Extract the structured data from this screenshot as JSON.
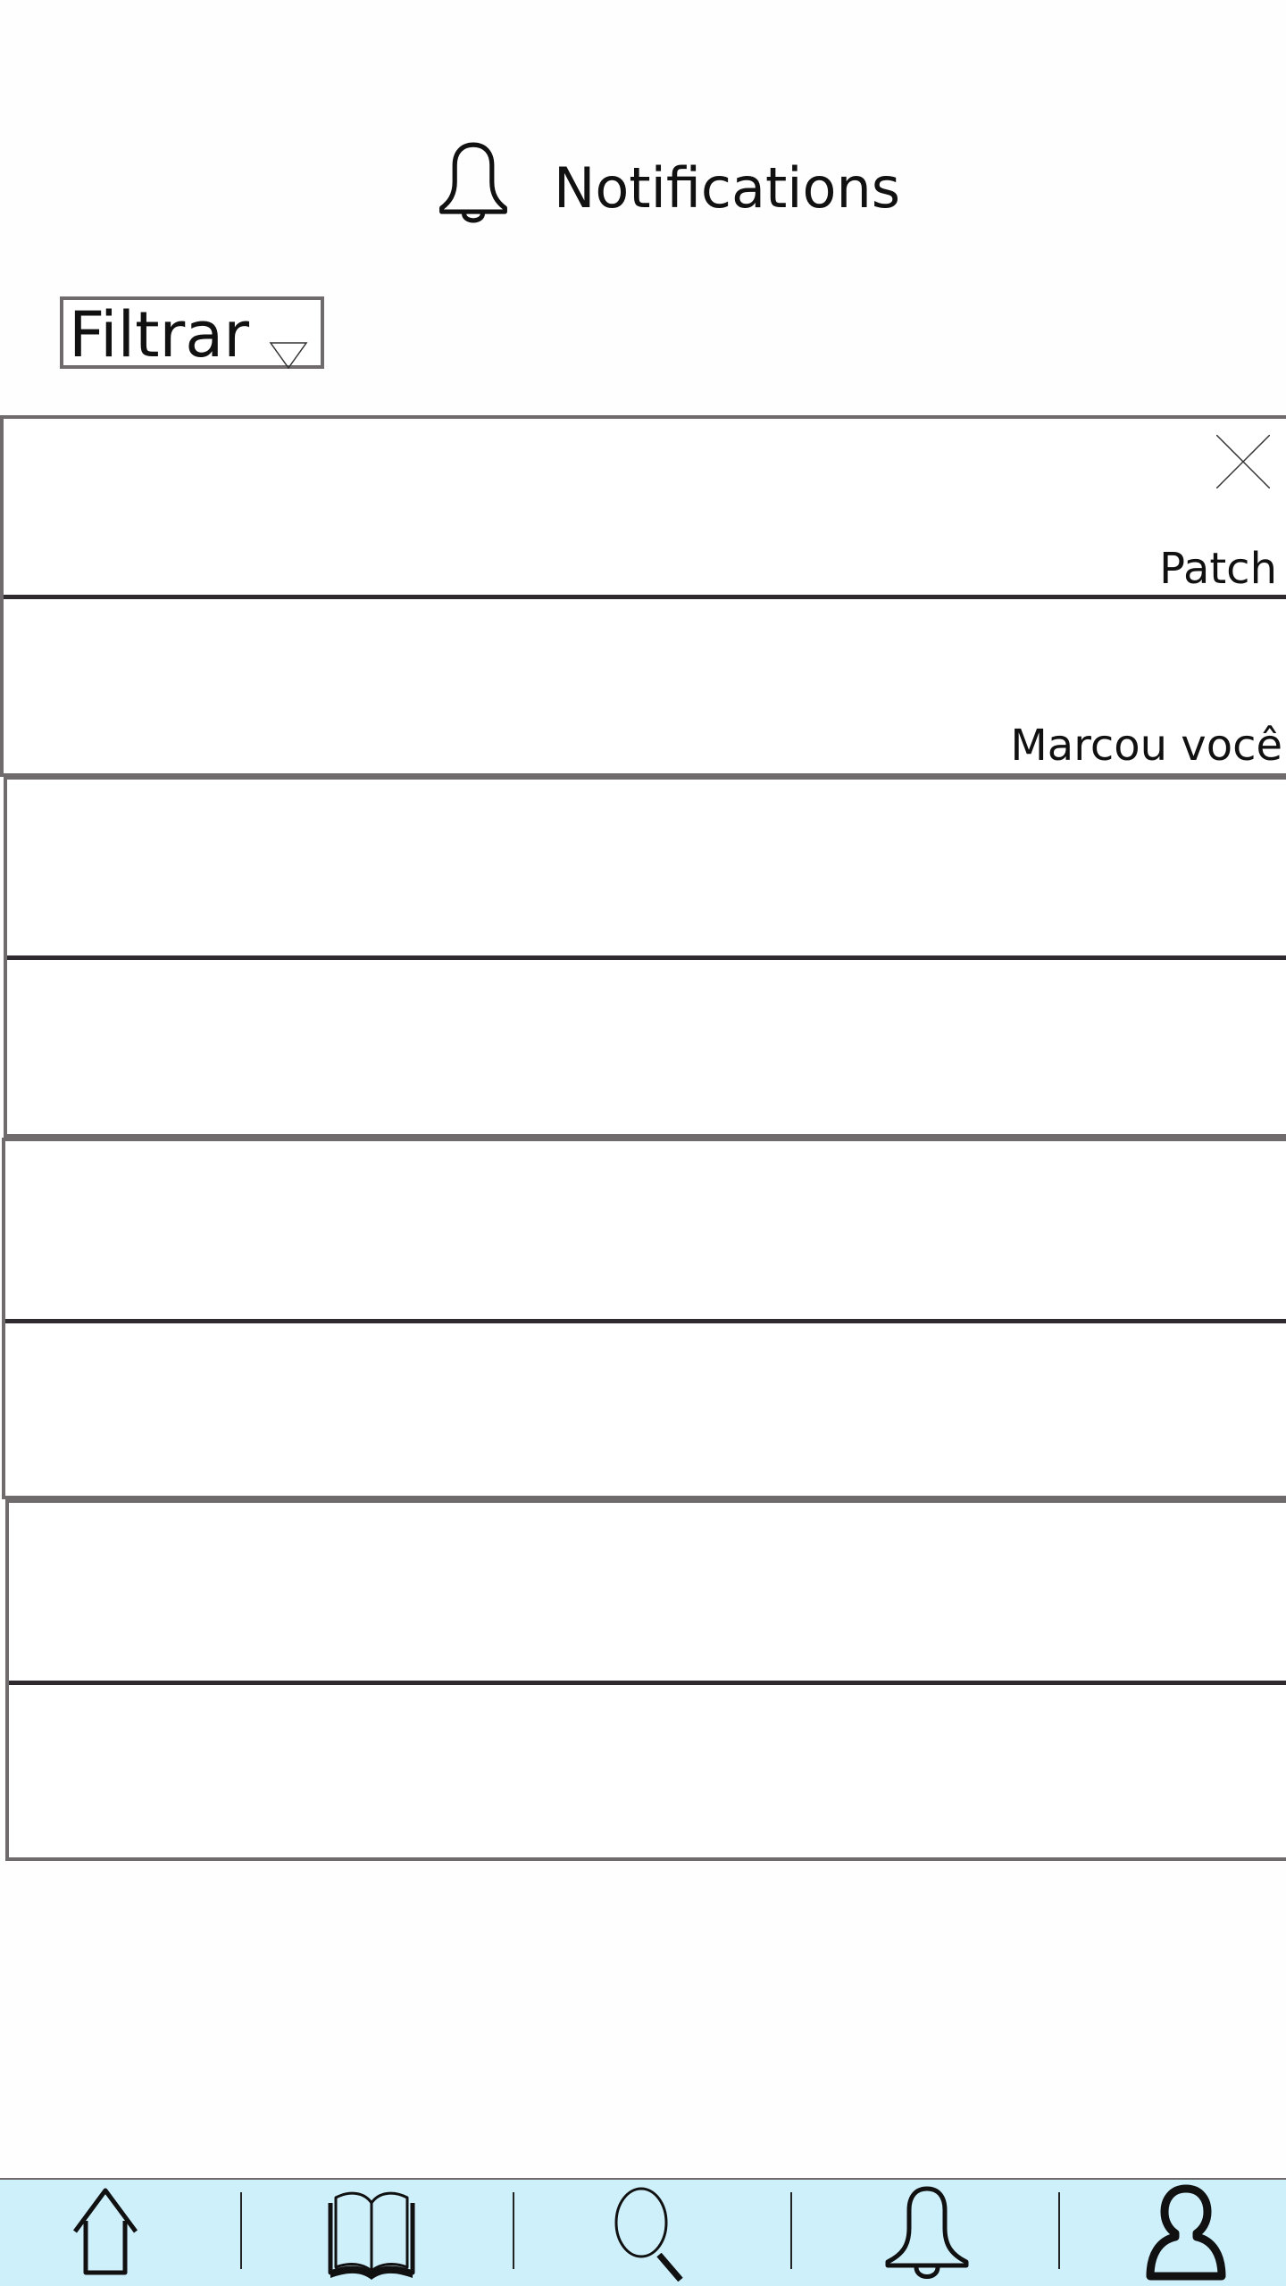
{
  "header": {
    "title": "Notifications",
    "icon": "bell-icon"
  },
  "filter": {
    "label": "Filtrar",
    "icon": "triangle-down-icon"
  },
  "notifications": [
    {
      "text": "Patch",
      "has_close": true
    },
    {
      "text": "Marcou você"
    },
    {
      "text": ""
    },
    {
      "text": ""
    },
    {
      "text": ""
    },
    {
      "text": ""
    },
    {
      "text": ""
    },
    {
      "text": ""
    }
  ],
  "nav": {
    "items": [
      {
        "icon": "home-icon"
      },
      {
        "icon": "book-icon"
      },
      {
        "icon": "search-icon"
      },
      {
        "icon": "bell-icon"
      },
      {
        "icon": "user-icon"
      }
    ],
    "background": "#cdf0fb"
  },
  "colors": {
    "border": "#6f6b6d",
    "divider": "#2f2a2d"
  }
}
